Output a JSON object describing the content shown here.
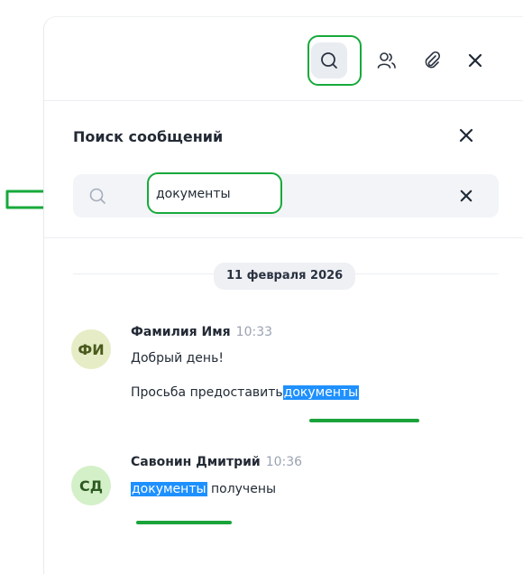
{
  "search": {
    "title": "Поиск сообщений",
    "query": "документы"
  },
  "date_separator": "11 февраля 2026",
  "messages": [
    {
      "initials": "ФИ",
      "author": "Фамилия Имя",
      "time": "10:33",
      "line1": "Добрый день!",
      "line2_prefix": "Просьба предоставить",
      "line2_highlight": "документы"
    },
    {
      "initials": "СД",
      "author": "Савонин Дмитрий",
      "time": "10:36",
      "line1_highlight": "документы",
      "line1_suffix": " получены"
    }
  ],
  "toolbar_icons": [
    "search-icon",
    "users-icon",
    "paperclip-icon",
    "close-icon"
  ],
  "colors": {
    "annotation_green": "#17a93b",
    "highlight_blue": "#1e90ff",
    "avatar1_bg": "#e6ecc5",
    "avatar2_bg": "#d3f0c9"
  }
}
